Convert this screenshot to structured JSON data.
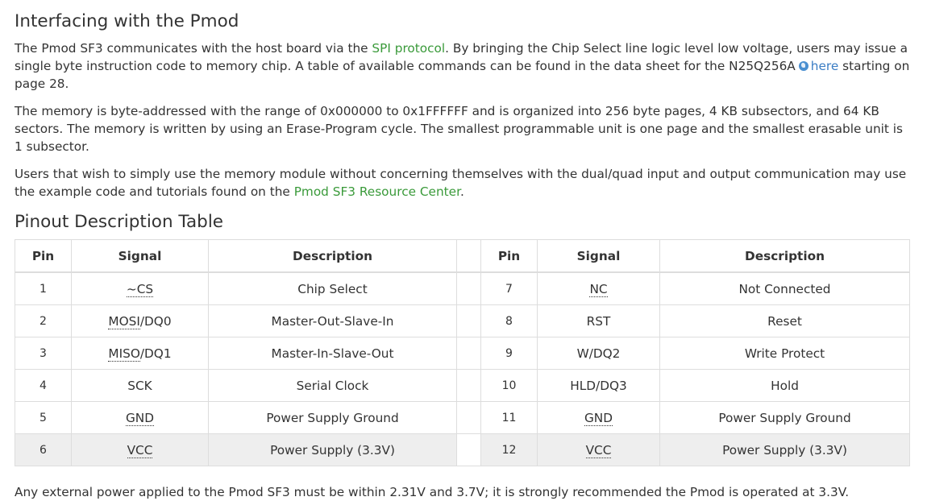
{
  "heading": "Interfacing with the Pmod",
  "p1": {
    "t1": "The Pmod SF3 communicates with the host board via the ",
    "link1": "SPI protocol",
    "t2": ". By bringing the Chip Select line logic level low voltage, users may issue a single byte instruction code to memory chip. A table of available commands can be found in the data sheet for the N25Q256A",
    "link2": "here",
    "t3": " starting on page 28."
  },
  "p2": "The memory is byte-addressed with the range of 0x000000 to 0x1FFFFFF and is organized into 256 byte pages, 4 KB subsectors, and 64 KB sectors. The memory is written by using an Erase-Program cycle. The smallest programmable unit is one page and the smallest erasable unit is 1 subsector.",
  "p3": {
    "t1": "Users that wish to simply use the memory module without concerning themselves with the dual/quad input and output communication may use the example code and tutorials found on the ",
    "link": "Pmod SF3 Resource Center",
    "t2": "."
  },
  "table_title": "Pinout Description Table",
  "table_headers": {
    "pin": "Pin",
    "signal": "Signal",
    "description": "Description"
  },
  "rows": [
    {
      "pin": "1",
      "sig_a": "~CS",
      "sig_b": "",
      "desc": "Chip Select",
      "pin2": "7",
      "sig2_a": "NC",
      "sig2_b": "",
      "desc2": "Not Connected"
    },
    {
      "pin": "2",
      "sig_a": "MOSI",
      "sig_b": "/DQ0",
      "desc": "Master-Out-Slave-In",
      "pin2": "8",
      "sig2_a": "",
      "sig2_b": "RST",
      "desc2": "Reset"
    },
    {
      "pin": "3",
      "sig_a": "MISO",
      "sig_b": "/DQ1",
      "desc": "Master-In-Slave-Out",
      "pin2": "9",
      "sig2_a": "",
      "sig2_b": "W/DQ2",
      "desc2": "Write Protect"
    },
    {
      "pin": "4",
      "sig_a": "",
      "sig_b": "SCK",
      "desc": "Serial Clock",
      "pin2": "10",
      "sig2_a": "",
      "sig2_b": "HLD/DQ3",
      "desc2": "Hold"
    },
    {
      "pin": "5",
      "sig_a": "GND",
      "sig_b": "",
      "desc": "Power Supply Ground",
      "pin2": "11",
      "sig2_a": "GND",
      "sig2_b": "",
      "desc2": "Power Supply Ground"
    },
    {
      "pin": "6",
      "sig_a": "VCC",
      "sig_b": "",
      "desc": "Power Supply (3.3V)",
      "pin2": "12",
      "sig2_a": "VCC",
      "sig2_b": "",
      "desc2": "Power Supply (3.3V)"
    }
  ],
  "footer": "Any external power applied to the Pmod SF3 must be within 2.31V and 3.7V; it is strongly recommended the Pmod is operated at 3.3V.",
  "colors": {
    "link_green": "#3a9a3a",
    "link_blue": "#3b7dc4",
    "shaded_row": "#eeeeee",
    "border": "#dddddd"
  },
  "icons": {
    "external_link": "globe-icon"
  }
}
